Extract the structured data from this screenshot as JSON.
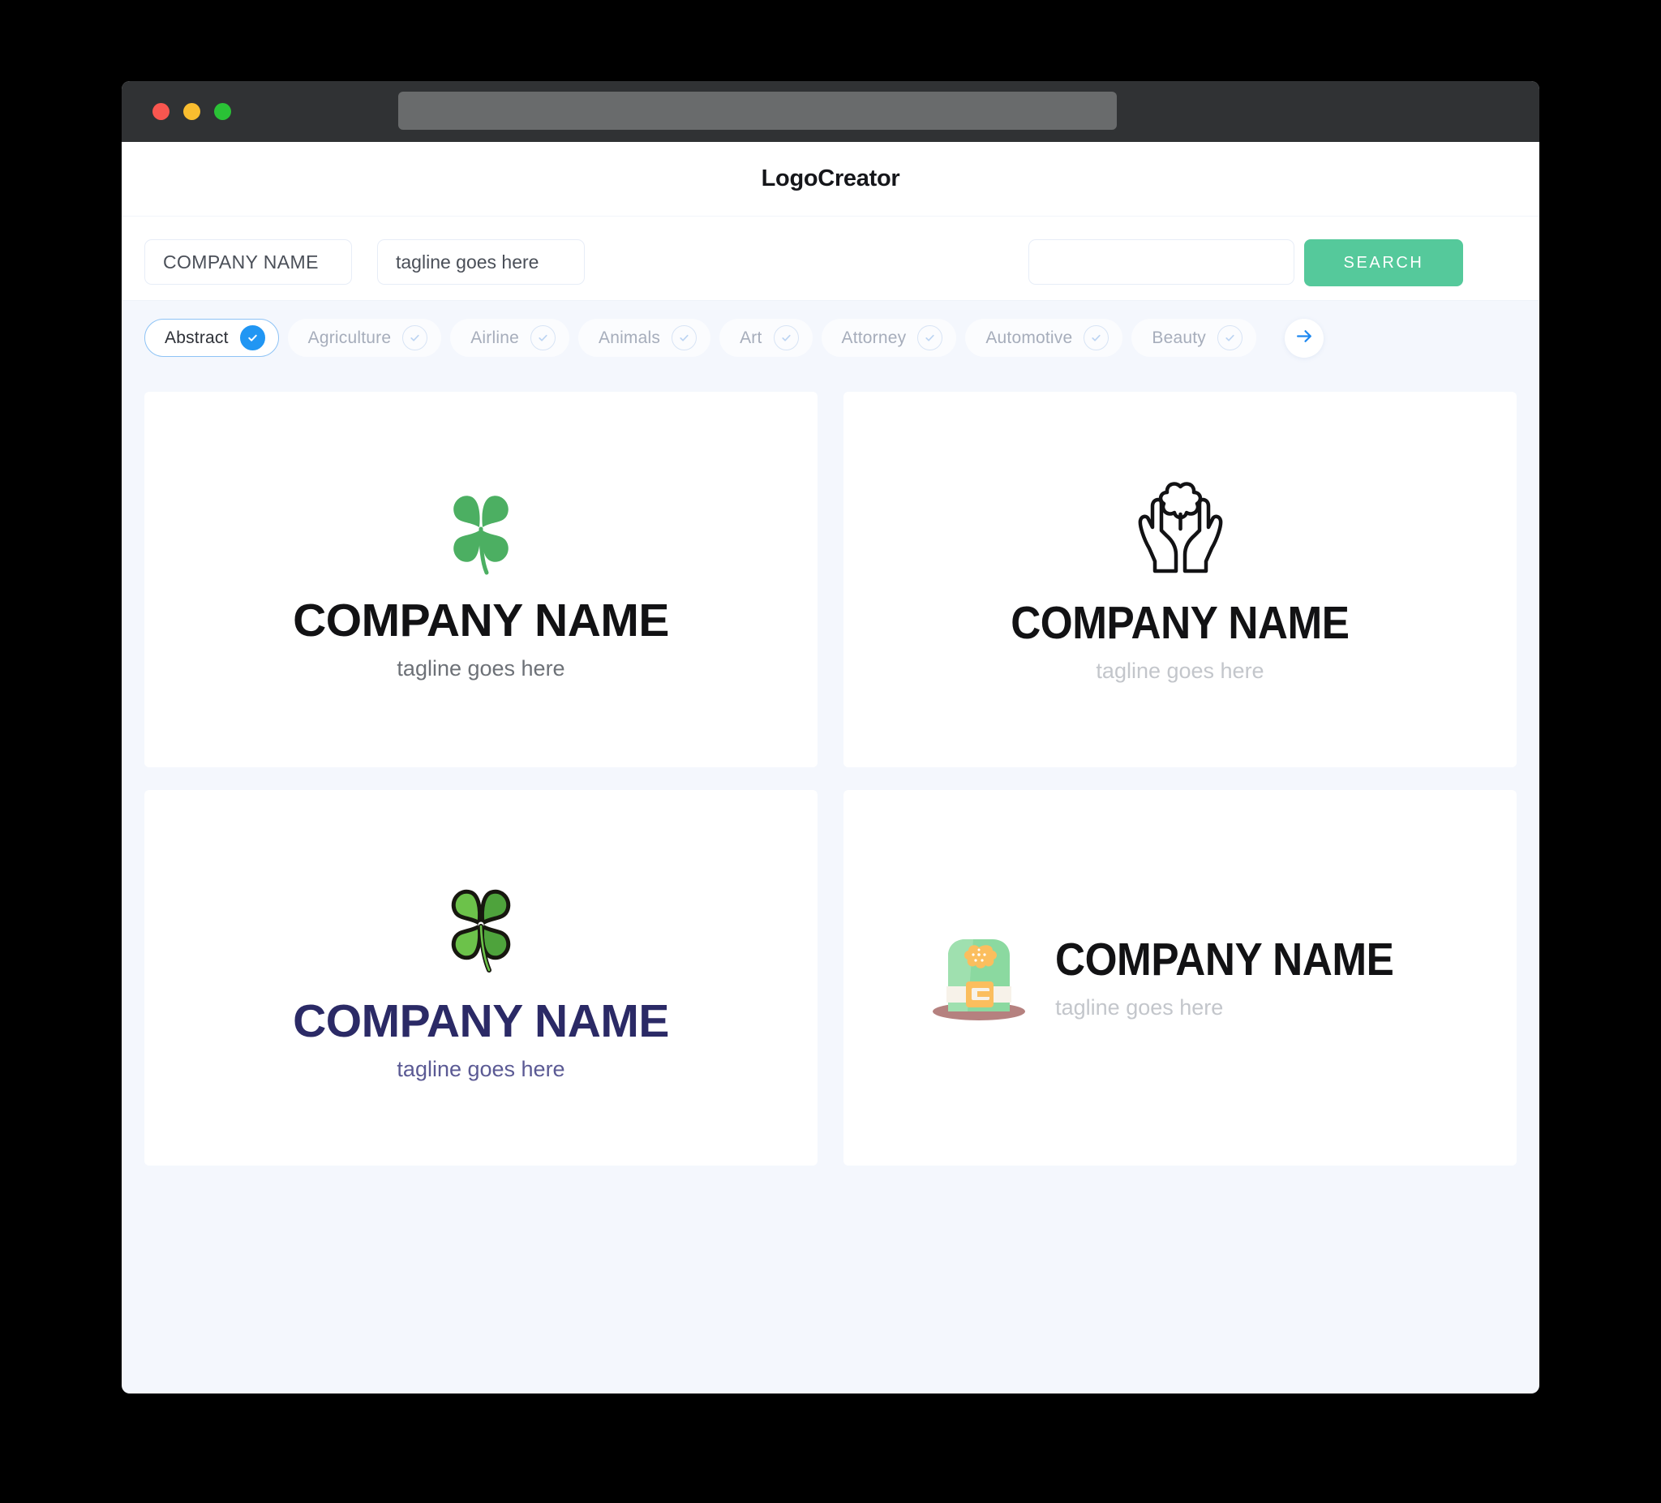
{
  "window": {
    "traffic_lights": [
      "close",
      "minimize",
      "maximize"
    ],
    "url_bar_value": ""
  },
  "header": {
    "app_title": "LogoCreator"
  },
  "search": {
    "company_name_value": "COMPANY NAME",
    "company_name_placeholder": "COMPANY NAME",
    "tagline_value": "tagline goes here",
    "tagline_placeholder": "tagline goes here",
    "extra_value": "",
    "extra_placeholder": "",
    "search_button_label": "SEARCH",
    "search_button_color": "#55c99b"
  },
  "categories": {
    "selected": "Abstract",
    "next_icon": "arrow-right-icon",
    "items": [
      {
        "label": "Abstract",
        "selected": true,
        "icon": "check-circle-icon"
      },
      {
        "label": "Agriculture",
        "selected": false,
        "icon": "check-circle-icon"
      },
      {
        "label": "Airline",
        "selected": false,
        "icon": "check-circle-icon"
      },
      {
        "label": "Animals",
        "selected": false,
        "icon": "check-circle-icon"
      },
      {
        "label": "Art",
        "selected": false,
        "icon": "check-circle-icon"
      },
      {
        "label": "Attorney",
        "selected": false,
        "icon": "check-circle-icon"
      },
      {
        "label": "Automotive",
        "selected": false,
        "icon": "check-circle-icon"
      },
      {
        "label": "Beauty",
        "selected": false,
        "icon": "check-circle-icon"
      }
    ]
  },
  "results": {
    "cards": [
      {
        "icon": "four-leaf-clover-icon",
        "name": "COMPANY NAME",
        "tagline": "tagline goes here",
        "name_color": "#121214",
        "tagline_color": "#6d7177",
        "mark_color": "#4caf62",
        "layout": "stacked"
      },
      {
        "icon": "hands-holding-clover-icon",
        "name": "COMPANY NAME",
        "tagline": "tagline goes here",
        "name_color": "#121214",
        "tagline_color": "#c3c6cb",
        "mark_color": "#121214",
        "layout": "stacked"
      },
      {
        "icon": "outlined-clover-icon",
        "name": "COMPANY NAME",
        "tagline": "tagline goes here",
        "name_color": "#2b2a66",
        "tagline_color": "#5b5a94",
        "mark_color": "#55b84a",
        "layout": "stacked"
      },
      {
        "icon": "leprechaun-hat-icon",
        "name": "COMPANY NAME",
        "tagline": "tagline goes here",
        "name_color": "#121214",
        "tagline_color": "#c3c6cb",
        "mark_color": "#8bd9a0",
        "layout": "horizontal"
      }
    ]
  }
}
